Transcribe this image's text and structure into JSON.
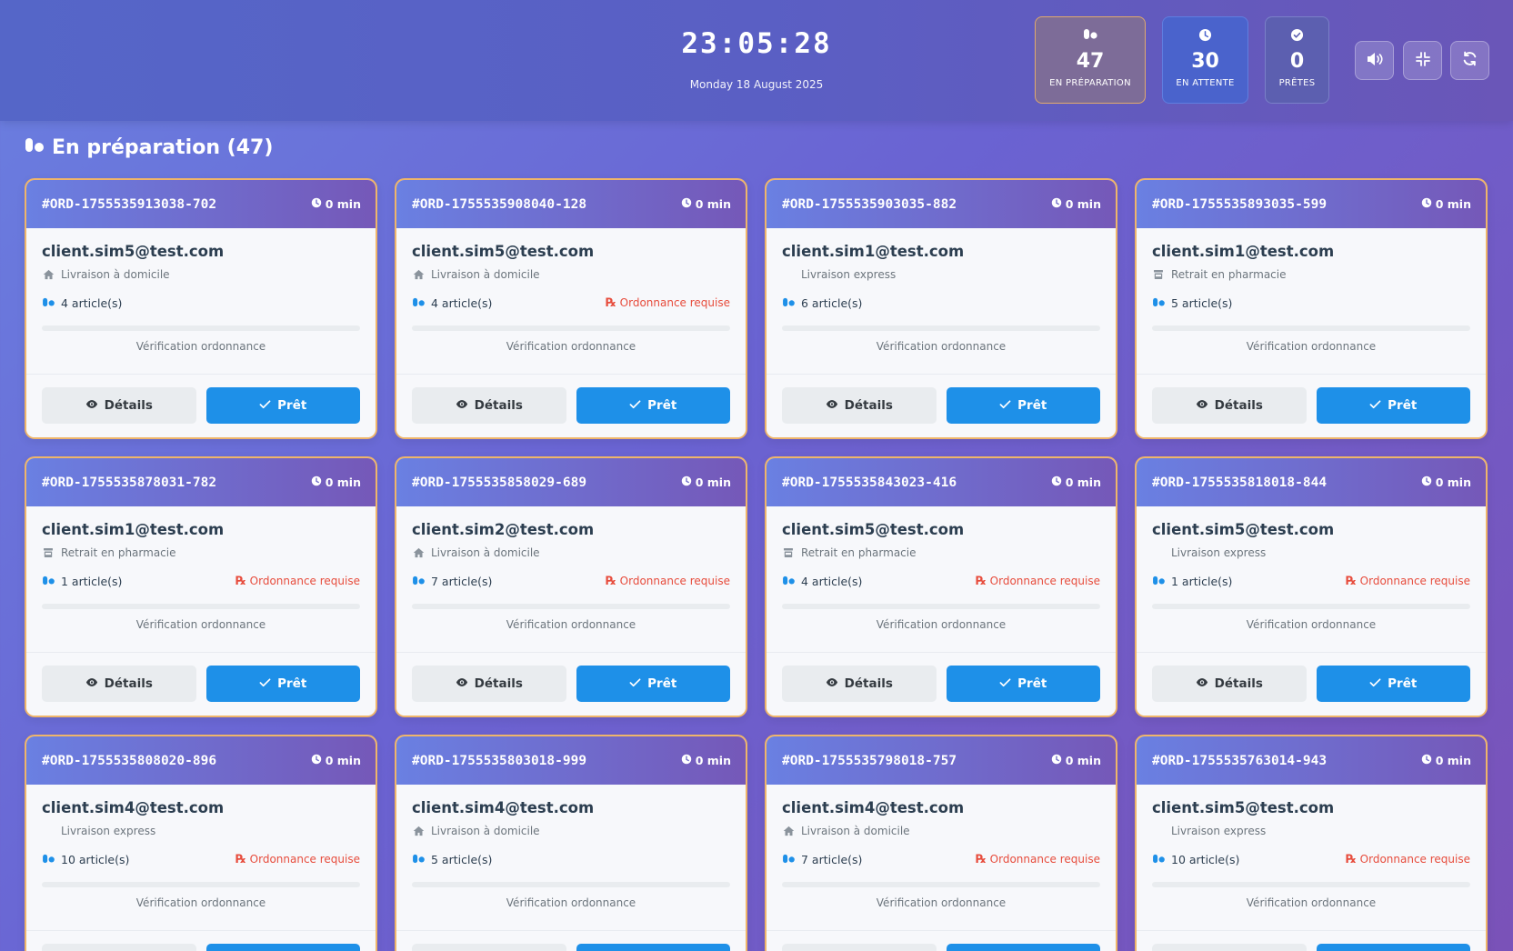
{
  "header": {
    "clock": "23:05:28",
    "date": "Monday 18 August 2025",
    "stats": [
      {
        "icon": "pills-icon",
        "value": "47",
        "label": "EN PRÉPARATION"
      },
      {
        "icon": "clock-icon",
        "value": "30",
        "label": "EN ATTENTE"
      },
      {
        "icon": "check-circle-icon",
        "value": "0",
        "label": "PRÊTES"
      }
    ]
  },
  "section": {
    "title": "En préparation (47)"
  },
  "labels": {
    "details": "Détails",
    "ready": "Prêt",
    "rx_required": "Ordonnance requise",
    "step": "Vérification ordonnance"
  },
  "orders": [
    {
      "id": "#ORD-1755535913038-702",
      "time": "0 min",
      "email": "client.sim5@test.com",
      "delivery": "Livraison à domicile",
      "delivery_icon": "home",
      "items": "4 article(s)",
      "rx": false
    },
    {
      "id": "#ORD-1755535908040-128",
      "time": "0 min",
      "email": "client.sim5@test.com",
      "delivery": "Livraison à domicile",
      "delivery_icon": "home",
      "items": "4 article(s)",
      "rx": true
    },
    {
      "id": "#ORD-1755535903035-882",
      "time": "0 min",
      "email": "client.sim1@test.com",
      "delivery": "Livraison express",
      "delivery_icon": "none",
      "items": "6 article(s)",
      "rx": false
    },
    {
      "id": "#ORD-1755535893035-599",
      "time": "0 min",
      "email": "client.sim1@test.com",
      "delivery": "Retrait en pharmacie",
      "delivery_icon": "store",
      "items": "5 article(s)",
      "rx": false
    },
    {
      "id": "#ORD-1755535878031-782",
      "time": "0 min",
      "email": "client.sim1@test.com",
      "delivery": "Retrait en pharmacie",
      "delivery_icon": "store",
      "items": "1 article(s)",
      "rx": true
    },
    {
      "id": "#ORD-1755535858029-689",
      "time": "0 min",
      "email": "client.sim2@test.com",
      "delivery": "Livraison à domicile",
      "delivery_icon": "home",
      "items": "7 article(s)",
      "rx": true
    },
    {
      "id": "#ORD-1755535843023-416",
      "time": "0 min",
      "email": "client.sim5@test.com",
      "delivery": "Retrait en pharmacie",
      "delivery_icon": "store",
      "items": "4 article(s)",
      "rx": true
    },
    {
      "id": "#ORD-1755535818018-844",
      "time": "0 min",
      "email": "client.sim5@test.com",
      "delivery": "Livraison express",
      "delivery_icon": "none",
      "items": "1 article(s)",
      "rx": true
    },
    {
      "id": "#ORD-1755535808020-896",
      "time": "0 min",
      "email": "client.sim4@test.com",
      "delivery": "Livraison express",
      "delivery_icon": "none",
      "items": "10 article(s)",
      "rx": true
    },
    {
      "id": "#ORD-1755535803018-999",
      "time": "0 min",
      "email": "client.sim4@test.com",
      "delivery": "Livraison à domicile",
      "delivery_icon": "home",
      "items": "5 article(s)",
      "rx": false
    },
    {
      "id": "#ORD-1755535798018-757",
      "time": "0 min",
      "email": "client.sim4@test.com",
      "delivery": "Livraison à domicile",
      "delivery_icon": "home",
      "items": "7 article(s)",
      "rx": true
    },
    {
      "id": "#ORD-1755535763014-943",
      "time": "0 min",
      "email": "client.sim5@test.com",
      "delivery": "Livraison express",
      "delivery_icon": "none",
      "items": "10 article(s)",
      "rx": true
    }
  ],
  "colors": {
    "accent_blue": "#1e90e8",
    "rx_red": "#e74c3c",
    "card_border": "#efb56a"
  }
}
